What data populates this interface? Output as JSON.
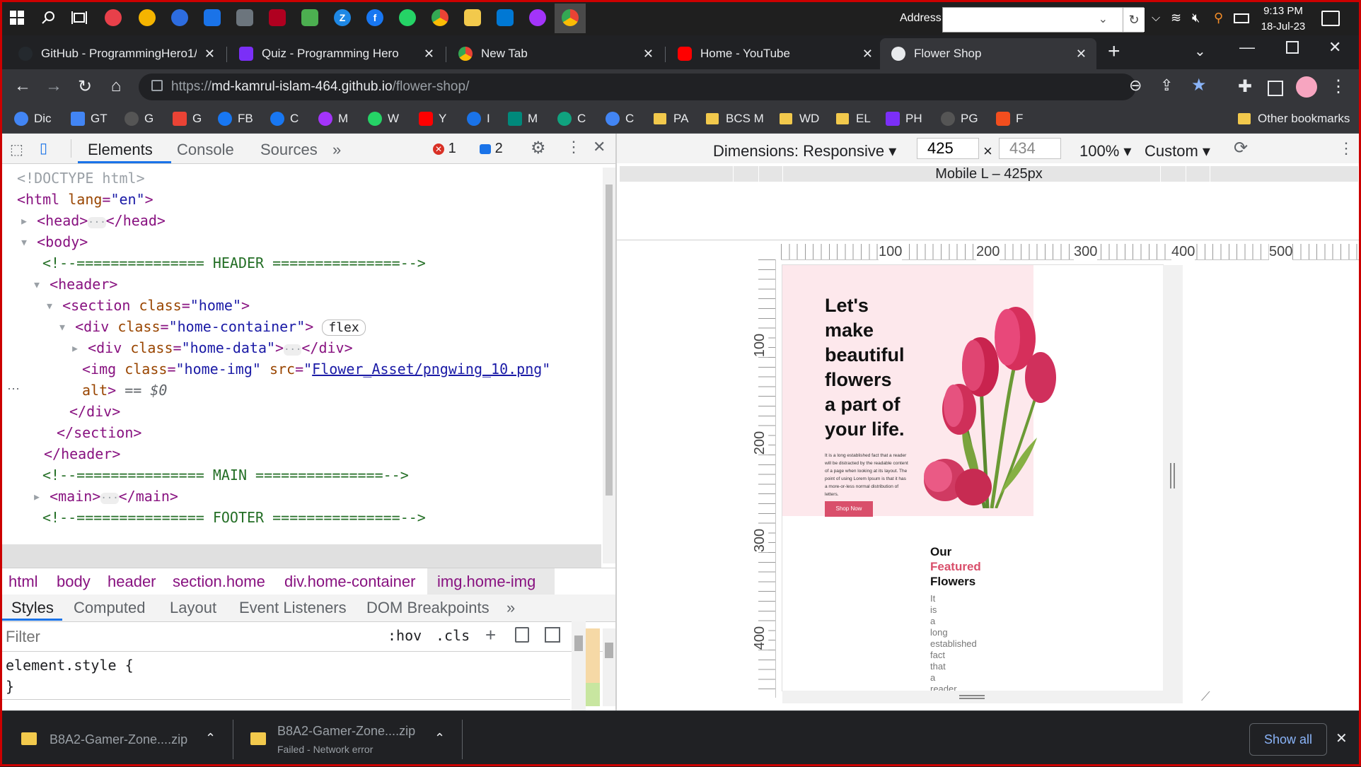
{
  "taskbar": {
    "address_label": "Address",
    "time": "9:13 PM",
    "date": "18-Jul-23"
  },
  "tabs": [
    {
      "title": "GitHub - ProgrammingHero1/",
      "favicon": "github-icon",
      "active": false
    },
    {
      "title": "Quiz - Programming Hero",
      "favicon": "programming-hero-icon",
      "active": false
    },
    {
      "title": "New Tab",
      "favicon": "chrome-icon",
      "active": false
    },
    {
      "title": "Home - YouTube",
      "favicon": "youtube-icon",
      "active": false
    },
    {
      "title": "Flower Shop",
      "favicon": "globe-icon",
      "active": true
    }
  ],
  "toolbar": {
    "url_prefix": "https://",
    "url_host": "md-kamrul-islam-464.github.io",
    "url_path": "/flower-shop/"
  },
  "bookmarks": [
    {
      "label": "Dic",
      "icon": "google-icon",
      "color": "#4285f4"
    },
    {
      "label": "GT",
      "icon": "google-translate-icon",
      "color": "#4285f4"
    },
    {
      "label": "G",
      "icon": "github-icon",
      "color": "#555555"
    },
    {
      "label": "G",
      "icon": "gmail-icon",
      "color": "#ea4335"
    },
    {
      "label": "FB",
      "icon": "facebook-icon",
      "color": "#1877f2"
    },
    {
      "label": "C",
      "icon": "facebook-icon",
      "color": "#1877f2"
    },
    {
      "label": "M",
      "icon": "messenger-icon",
      "color": "#a334fa"
    },
    {
      "label": "W",
      "icon": "whatsapp-icon",
      "color": "#25d366"
    },
    {
      "label": "Y",
      "icon": "youtube-icon",
      "color": "#ff0000"
    },
    {
      "label": "I",
      "icon": "site-icon",
      "color": "#1a73e8"
    },
    {
      "label": "M",
      "icon": "meet-icon",
      "color": "#00897b"
    },
    {
      "label": "C",
      "icon": "chatgpt-icon",
      "color": "#10a37f"
    },
    {
      "label": "C",
      "icon": "google-icon",
      "color": "#4285f4"
    },
    {
      "label": "PA",
      "icon": "folder-icon",
      "color": "#f2c94c"
    },
    {
      "label": "BCS M",
      "icon": "folder-icon",
      "color": "#f2c94c"
    },
    {
      "label": "WD",
      "icon": "folder-icon",
      "color": "#f2c94c"
    },
    {
      "label": "EL",
      "icon": "folder-icon",
      "color": "#f2c94c"
    },
    {
      "label": "PH",
      "icon": "programming-hero-icon",
      "color": "#7b2ff7"
    },
    {
      "label": "PG",
      "icon": "github-icon",
      "color": "#555555"
    },
    {
      "label": "F",
      "icon": "figma-icon",
      "color": "#f24e1e"
    }
  ],
  "other_bookmarks": "Other bookmarks",
  "devtools": {
    "tabs": [
      "Elements",
      "Console",
      "Sources"
    ],
    "more": "»",
    "error_count": "1",
    "message_count": "2",
    "code_lines": {
      "l1": "<!DOCTYPE html>",
      "l2_tag": "<html ",
      "l2_attr": "lang",
      "l2_val": "\"en\"",
      "l2_end": ">",
      "l3_open": "<head>",
      "l3_close": "</head>",
      "l4": "<body>",
      "l5": "<!--=============== HEADER ===============-->",
      "l6": "<header>",
      "l7_tag": "<section ",
      "l7_attr": "class",
      "l7_val": "\"home\"",
      "l7_end": ">",
      "l8_tag": "<div ",
      "l8_attr": "class",
      "l8_val": "\"home-container\"",
      "l8_end": ">",
      "l8_badge": "flex",
      "l9_tag": "<div ",
      "l9_attr": "class",
      "l9_val": "\"home-data\"",
      "l9_end": ">",
      "l9_close": "</div>",
      "l10_tag": "<img ",
      "l10_attr1": "class",
      "l10_val1": "\"home-img\"",
      "l10_attr2": "src",
      "l10_link": "Flower_Asset/pngwing_10.png",
      "l10_quote": "\"",
      "l11_attr": "alt",
      "l11_end": ">",
      "l11_eq": " == $0",
      "l12": "</div>",
      "l13": "</section>",
      "l14": "</header>",
      "l15": "<!--=============== MAIN ===============-->",
      "l16_open": "<main>",
      "l16_close": "</main>",
      "l17": "<!--=============== FOOTER ===============-->"
    },
    "breadcrumbs": [
      "html",
      "body",
      "header",
      "section.home",
      "div.home-container",
      "img.home-img"
    ],
    "style_tabs": [
      "Styles",
      "Computed",
      "Layout",
      "Event Listeners",
      "DOM Breakpoints"
    ],
    "filter_placeholder": "Filter",
    "hov": ":hov",
    "cls": ".cls",
    "element_style": "element.style {",
    "close_brace": "}"
  },
  "device": {
    "dimensions_label": "Dimensions: Responsive",
    "width": "425",
    "height": "434",
    "times": "×",
    "zoom": "100%",
    "throttle": "Custom",
    "media_label": "Mobile L – 425px",
    "ruler_h": [
      "100",
      "200",
      "300",
      "400",
      "500"
    ],
    "ruler_v": [
      "100",
      "200",
      "300",
      "400"
    ]
  },
  "site": {
    "hero_title_lines": [
      "Let's",
      "make",
      "beautiful",
      "flowers",
      "a part of",
      "your life."
    ],
    "hero_text": "It is a long established fact that a reader will be distracted by the readable content of a page when looking at its layout. The point of using Lorem Ipsum is that it has a more-or-less normal distribution of letters.",
    "shop_button": "Shop Now",
    "featured_title": [
      "Our",
      "Featured",
      "Flowers"
    ],
    "featured_text_words": [
      "It",
      "is",
      "a",
      "long",
      "established",
      "fact",
      "that",
      "a",
      "reader"
    ],
    "brand_color": "#d94f6b"
  },
  "downloads": [
    {
      "name": "B8A2-Gamer-Zone....zip",
      "status": ""
    },
    {
      "name": "B8A2-Gamer-Zone....zip",
      "status": "Failed - Network error"
    }
  ],
  "show_all": "Show all"
}
